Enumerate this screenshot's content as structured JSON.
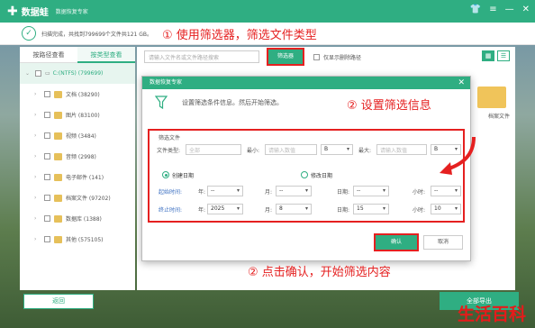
{
  "titlebar": {
    "app_name": "数据蛙",
    "subtitle": "数据恢复专家"
  },
  "infobar": {
    "scan_text": "扫描完成，共找到799699个文件共121 GB。"
  },
  "sidebar": {
    "tabs": [
      "按路径查看",
      "按类型查看"
    ],
    "root": "C:(NTFS) (799699)",
    "items": [
      {
        "label": "文档 (38290)"
      },
      {
        "label": "图片 (83100)"
      },
      {
        "label": "视频 (3484)"
      },
      {
        "label": "音频 (2998)"
      },
      {
        "label": "电子邮件 (141)"
      },
      {
        "label": "档案文件 (97202)"
      },
      {
        "label": "数据库 (1388)"
      },
      {
        "label": "其他 (575105)"
      }
    ]
  },
  "toolbar": {
    "search_placeholder": "请输入文件名或文件路径搜索",
    "filter_button": "筛选器",
    "only_deleted": "仅显示删除路径"
  },
  "content": {
    "folder_label": "档案文件"
  },
  "footer": {
    "back_button": "返回",
    "restore_button": "全部导出"
  },
  "annotations": {
    "step1": "① 使用筛选器，筛选文件类型",
    "step2": "② 设置筛选信息",
    "step3": "② 点击确认，开始筛选内容"
  },
  "dialog": {
    "title": "数据恢复专家",
    "hint": "设置筛选条件信息。然后开始筛选。",
    "section_title": "筛选文件",
    "file_type_label": "文件类型:",
    "file_type_placeholder": "全部",
    "min_label": "最小:",
    "min_placeholder": "请输入数值",
    "min_unit": "B",
    "max_label": "最大:",
    "max_placeholder": "请输入数值",
    "max_unit": "B",
    "create_date_label": "创建日期",
    "modify_date_label": "修改日期",
    "start_time_label": "起始时间:",
    "end_time_label": "终止时间:",
    "year_label": "年:",
    "month_label": "月:",
    "day_label": "日期:",
    "hour_label": "小时:",
    "start_year": "--",
    "start_month": "--",
    "start_day": "--",
    "start_hour": "--",
    "end_year": "2025",
    "end_month": "8",
    "end_day": "15",
    "end_hour": "10",
    "ok_button": "确认",
    "cancel_button": "取消"
  },
  "watermark": "生活百科",
  "colors": {
    "accent": "#2fae82",
    "highlight": "#e52020"
  }
}
